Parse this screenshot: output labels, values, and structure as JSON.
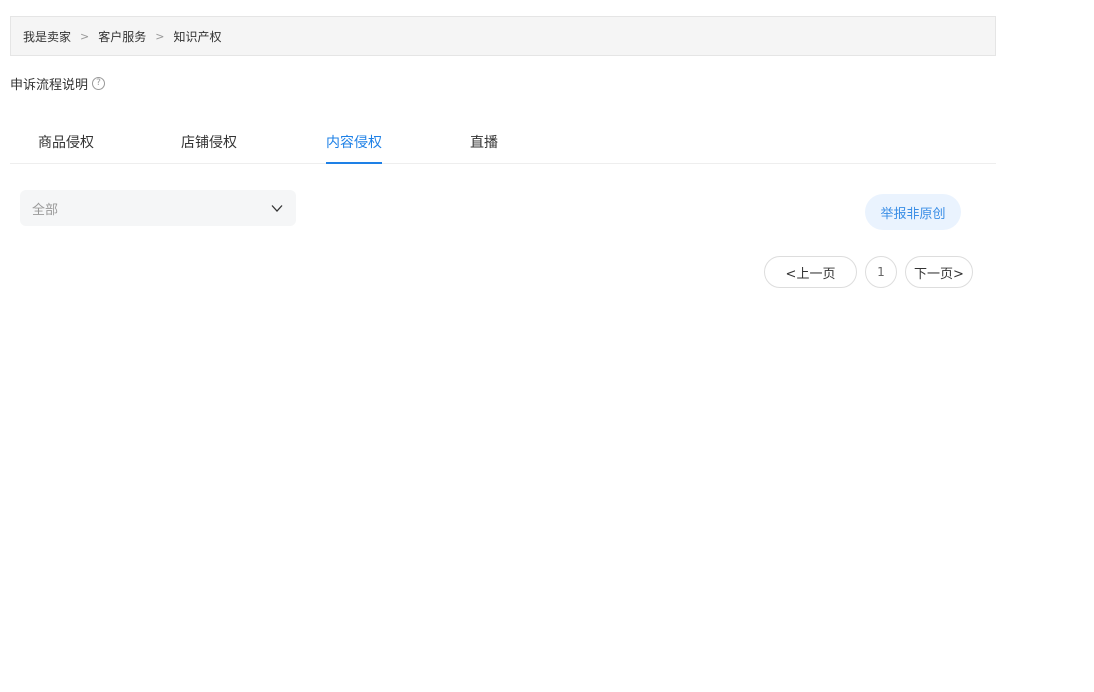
{
  "breadcrumb": {
    "items": [
      "我是卖家",
      "客户服务",
      "知识产权"
    ],
    "separator": ">"
  },
  "appeal": {
    "label": "申诉流程说明",
    "help_glyph": "?"
  },
  "tabs": [
    {
      "label": "商品侵权",
      "active": false
    },
    {
      "label": "店铺侵权",
      "active": false
    },
    {
      "label": "内容侵权",
      "active": true
    },
    {
      "label": "直播",
      "active": false
    }
  ],
  "filter": {
    "selected": "全部"
  },
  "actions": {
    "report_label": "举报非原创"
  },
  "pagination": {
    "prev_label": "<上一页",
    "current_page": "1",
    "next_label": "下一页>"
  },
  "colors": {
    "accent": "#1e80e6",
    "report_bg": "#eaf3fe",
    "report_text": "#3a8ee6"
  }
}
